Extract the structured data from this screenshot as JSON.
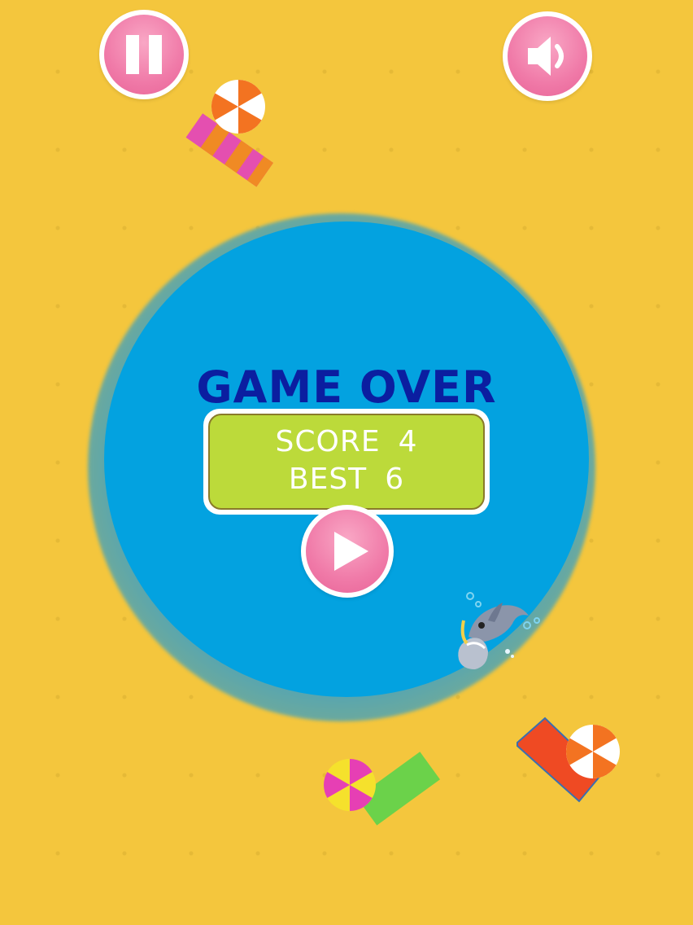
{
  "title": "GAME OVER",
  "score": {
    "label": "SCORE",
    "value": "4"
  },
  "best": {
    "label": "BEST",
    "value": "6"
  },
  "buttons": {
    "pause": {
      "icon": "pause-icon"
    },
    "sound": {
      "icon": "speaker-icon"
    },
    "play": {
      "icon": "play-icon"
    }
  },
  "colors": {
    "background": "#f4c63d",
    "pool": "#03a2e0",
    "title": "#0b1ea0",
    "button_pink": "#f07aa8",
    "panel_green": "#bcda3a"
  }
}
